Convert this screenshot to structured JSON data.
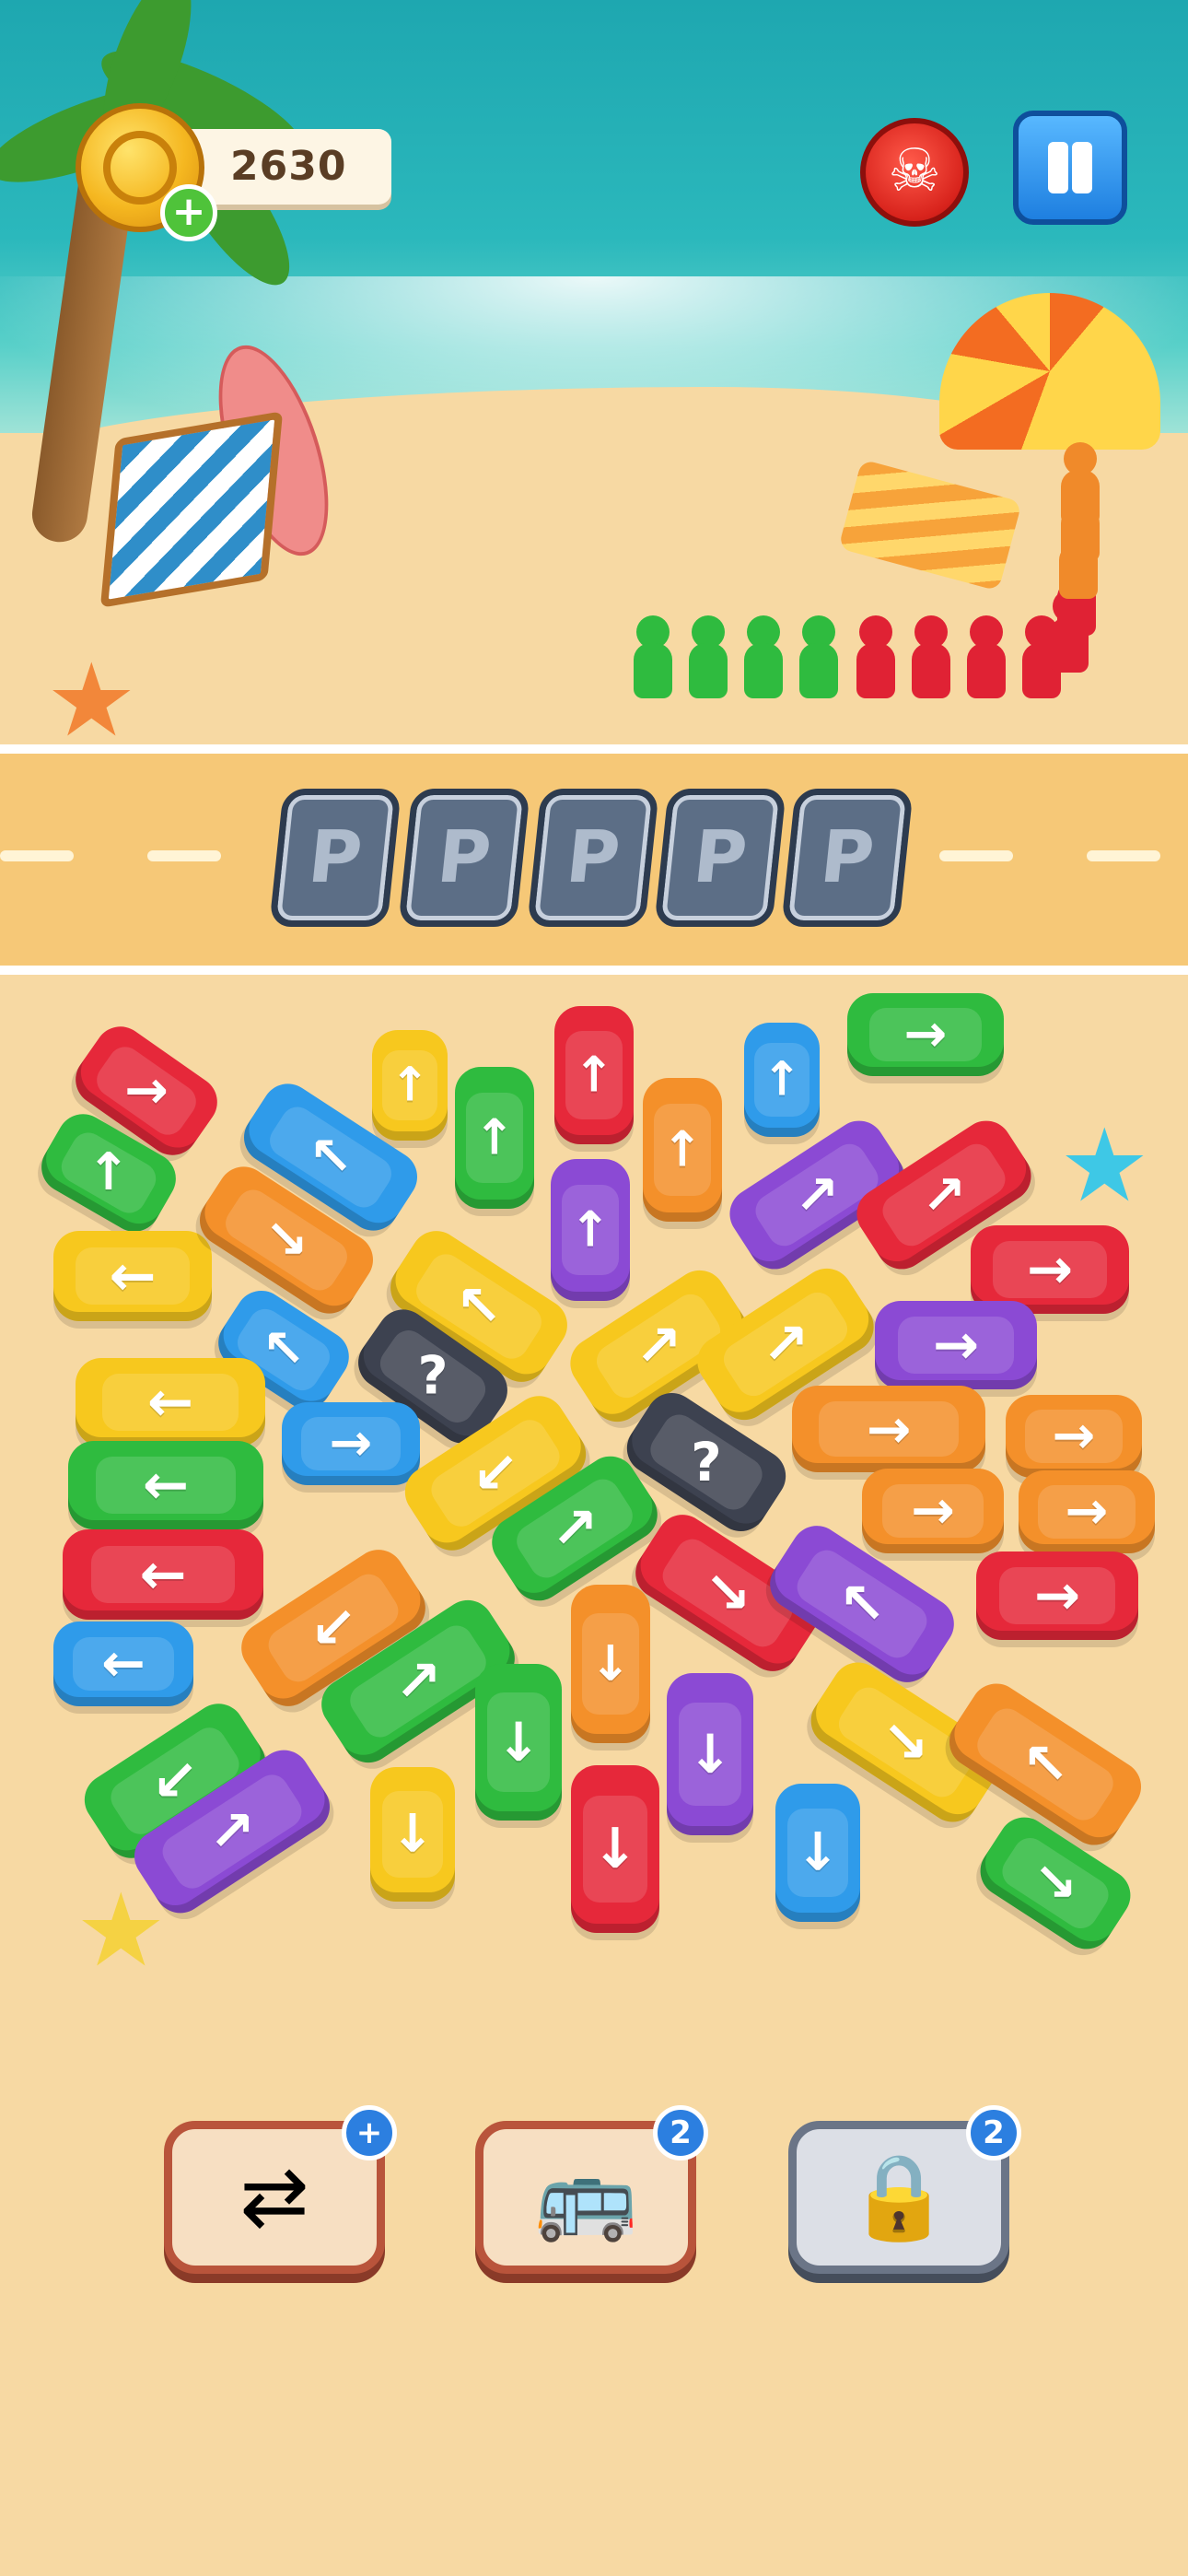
{
  "hud": {
    "coins": "2630",
    "coin_add_symbol": "+",
    "skull_symbol": "☠"
  },
  "parking": {
    "slots": [
      "P",
      "P",
      "P",
      "P",
      "P"
    ]
  },
  "queue": {
    "colors": [
      "#2fbb3f",
      "#2fbb3f",
      "#2fbb3f",
      "#2fbb3f",
      "#e02234",
      "#e02234",
      "#e02234",
      "#e02234",
      "#e02234",
      "#e02234",
      "#f08a2a",
      "#f08a2a",
      "#f08a2a"
    ]
  },
  "cars": [
    {
      "color": "red",
      "dir": "→"
    },
    {
      "color": "yellow",
      "dir": "↑"
    },
    {
      "color": "red",
      "dir": "↑"
    },
    {
      "color": "blue",
      "dir": "↑"
    },
    {
      "color": "green",
      "dir": "→"
    },
    {
      "color": "green",
      "dir": "↑"
    },
    {
      "color": "blue",
      "dir": "↖"
    },
    {
      "color": "green",
      "dir": "↑"
    },
    {
      "color": "orange",
      "dir": "↑"
    },
    {
      "color": "purple",
      "dir": "↗"
    },
    {
      "color": "red",
      "dir": "↗"
    },
    {
      "color": "purple",
      "dir": "↑"
    },
    {
      "color": "yellow",
      "dir": "←"
    },
    {
      "color": "orange",
      "dir": "↘"
    },
    {
      "color": "yellow",
      "dir": "↖"
    },
    {
      "color": "red",
      "dir": "→"
    },
    {
      "color": "blue",
      "dir": "↖"
    },
    {
      "color": "dark",
      "dir": "?"
    },
    {
      "color": "yellow",
      "dir": "↗"
    },
    {
      "color": "yellow",
      "dir": "↗"
    },
    {
      "color": "purple",
      "dir": "→"
    },
    {
      "color": "yellow",
      "dir": "←"
    },
    {
      "color": "blue",
      "dir": "→"
    },
    {
      "color": "dark",
      "dir": "?"
    },
    {
      "color": "orange",
      "dir": "→"
    },
    {
      "color": "orange",
      "dir": "→"
    },
    {
      "color": "green",
      "dir": "←"
    },
    {
      "color": "yellow",
      "dir": "↙"
    },
    {
      "color": "green",
      "dir": "↗"
    },
    {
      "color": "orange",
      "dir": "→"
    },
    {
      "color": "orange",
      "dir": "→"
    },
    {
      "color": "red",
      "dir": "←"
    },
    {
      "color": "red",
      "dir": "↘"
    },
    {
      "color": "purple",
      "dir": "↖"
    },
    {
      "color": "red",
      "dir": "→"
    },
    {
      "color": "blue",
      "dir": "←"
    },
    {
      "color": "orange",
      "dir": "↙"
    },
    {
      "color": "green",
      "dir": "↗"
    },
    {
      "color": "orange",
      "dir": "↓"
    },
    {
      "color": "yellow",
      "dir": "↘"
    },
    {
      "color": "orange",
      "dir": "↖"
    },
    {
      "color": "green",
      "dir": "↓"
    },
    {
      "color": "purple",
      "dir": "↓"
    },
    {
      "color": "green",
      "dir": "↙"
    },
    {
      "color": "purple",
      "dir": "↗"
    },
    {
      "color": "yellow",
      "dir": "↓"
    },
    {
      "color": "red",
      "dir": "↓"
    },
    {
      "color": "blue",
      "dir": "↓"
    },
    {
      "color": "green",
      "dir": "↘"
    }
  ],
  "boosters": [
    {
      "name": "swap-passenger",
      "icon": "⇄",
      "badge": "+"
    },
    {
      "name": "shuffle-bus",
      "icon": "🚌",
      "badge": "2"
    },
    {
      "name": "unlock-slot",
      "icon": "🔒",
      "badge": "2"
    }
  ]
}
